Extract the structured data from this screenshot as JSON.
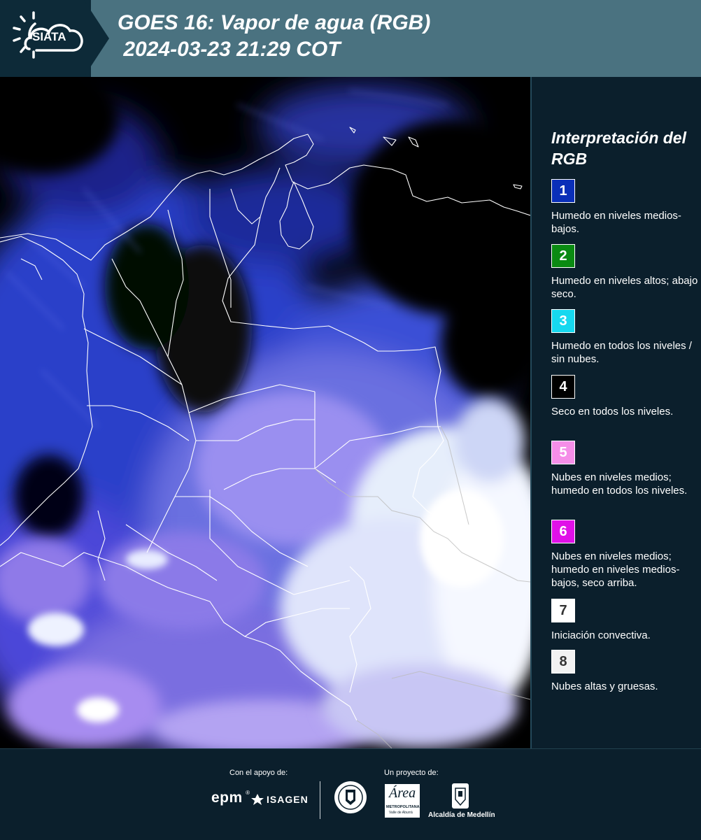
{
  "header": {
    "logo_text": "SIATA",
    "title_line1": "GOES 16: Vapor de agua (RGB)",
    "title_line2": " 2024-03-23 21:29 COT"
  },
  "legend": {
    "title": "Interpretación del RGB",
    "items": [
      {
        "num": "1",
        "color": "#0a2fb8",
        "num_color": "#ffffff",
        "text": "Humedo en niveles medios-bajos."
      },
      {
        "num": "2",
        "color": "#0a8a12",
        "num_color": "#ffffff",
        "text": "Humedo en niveles altos; abajo seco."
      },
      {
        "num": "3",
        "color": "#16d8ef",
        "num_color": "#ffffff",
        "text": "Humedo en todos los niveles / sin nubes."
      },
      {
        "num": "4",
        "color": "#000000",
        "num_color": "#ffffff",
        "text": "Seco en todos los niveles."
      },
      {
        "num": "5",
        "color": "#f58ee8",
        "num_color": "#ffffff",
        "text": "Nubes en niveles medios; humedo en todos los niveles."
      },
      {
        "num": "6",
        "color": "#e010e8",
        "num_color": "#ffffff",
        "text": "Nubes en niveles medios; humedo en niveles medios-bajos, seco arriba."
      },
      {
        "num": "7",
        "color": "#ffffff",
        "num_color": "#333333",
        "text": "Iniciación convectiva."
      },
      {
        "num": "8",
        "color": "#f2f2f2",
        "num_color": "#333333",
        "text": "Nubes altas y gruesas."
      }
    ]
  },
  "footer": {
    "support_label": "Con el apoyo de:",
    "project_label": "Un proyecto de:",
    "epm": "epm",
    "isagen": "ISAGEN",
    "area_main": "Área",
    "area_sub": "METROPOLITANA",
    "area_sub2": "Valle de Aburrá",
    "alcaldia": "Alcaldía de Medellín"
  }
}
